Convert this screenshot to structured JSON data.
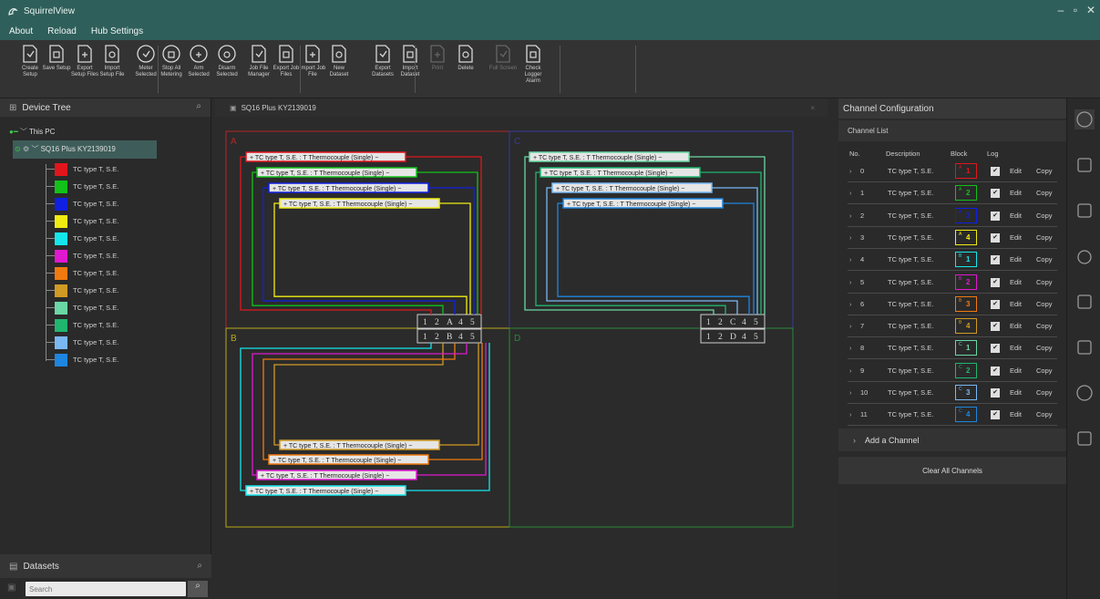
{
  "app": {
    "title": "SquirrelView"
  },
  "menu": [
    "About",
    "Reload",
    "Hub Settings"
  ],
  "toolbar": [
    {
      "label": "Create Setup",
      "icon": "create-setup-icon"
    },
    {
      "label": "Save Setup",
      "icon": "save-setup-icon"
    },
    {
      "label": "Export Setup Files",
      "icon": "export-setup-icon"
    },
    {
      "label": "Import Setup File",
      "icon": "import-setup-icon"
    },
    {
      "label": "Meter Selected",
      "icon": "meter-icon"
    },
    {
      "label": "Stop All Metering",
      "icon": "stop-metering-icon"
    },
    {
      "label": "Arm Selected",
      "icon": "arm-icon"
    },
    {
      "label": "Disarm Selected",
      "icon": "disarm-icon"
    },
    {
      "label": "Job File Manager",
      "icon": "job-file-manager-icon"
    },
    {
      "label": "Export Job Files",
      "icon": "export-job-icon"
    },
    {
      "label": "Import Job File",
      "icon": "import-job-icon"
    },
    {
      "label": "New Dataset",
      "icon": "new-dataset-icon"
    },
    {
      "label": "Export Datasets",
      "icon": "export-datasets-icon"
    },
    {
      "label": "Import Dataset",
      "icon": "import-dataset-icon"
    },
    {
      "label": "Print",
      "icon": "print-icon"
    },
    {
      "label": "Delete",
      "icon": "delete-icon"
    },
    {
      "label": "Full Screen",
      "icon": "full-screen-icon"
    },
    {
      "label": "Check Logger Alarm",
      "icon": "bell-icon"
    }
  ],
  "device_tree": {
    "title": "Device Tree",
    "root": "This PC",
    "logger": "SQ16 Plus KY2139019"
  },
  "channel_desc": "TC type T, S.E.",
  "channel_colors": [
    "#e0161c",
    "#12c21a",
    "#1020e0",
    "#f0ec12",
    "#14e6ec",
    "#e018d0",
    "#f07a10",
    "#d09a24",
    "#6ad8a4",
    "#20b66e",
    "#7ab8f2",
    "#1e86e0"
  ],
  "datasets": {
    "title": "Datasets",
    "search_placeholder": "Search"
  },
  "center": {
    "tab": "SQ16 Plus KY2139019",
    "quadrants": [
      "A",
      "B",
      "C",
      "D"
    ],
    "wire_label": "TC type T, S.E. : T Thermocouple (Single)",
    "terminals": {
      "A": [
        "1",
        "2",
        "A",
        "4",
        "5"
      ],
      "B": [
        "1",
        "2",
        "B",
        "4",
        "5"
      ],
      "C": [
        "1",
        "2",
        "C",
        "4",
        "5"
      ],
      "D": [
        "1",
        "2",
        "D",
        "4",
        "5"
      ]
    }
  },
  "config": {
    "title": "Channel Configuration",
    "list_title": "Channel List",
    "cols": {
      "no": "No.",
      "desc": "Description",
      "block": "Block",
      "log": "Log"
    },
    "edit": "Edit",
    "copy": "Copy",
    "check": "✔",
    "channels": [
      {
        "no": "0",
        "desc": "TC type T, S.E.",
        "blk": "A",
        "num": "1",
        "color": "#e0161c"
      },
      {
        "no": "1",
        "desc": "TC type T, S.E.",
        "blk": "A",
        "num": "2",
        "color": "#12c21a"
      },
      {
        "no": "2",
        "desc": "TC type T, S.E.",
        "blk": "A",
        "num": "3",
        "color": "#1020e0"
      },
      {
        "no": "3",
        "desc": "TC type T, S.E.",
        "blk": "A",
        "num": "4",
        "color": "#f0ec12"
      },
      {
        "no": "4",
        "desc": "TC type T, S.E.",
        "blk": "B",
        "num": "1",
        "color": "#14e6ec"
      },
      {
        "no": "5",
        "desc": "TC type T, S.E.",
        "blk": "B",
        "num": "2",
        "color": "#e018d0"
      },
      {
        "no": "6",
        "desc": "TC type T, S.E.",
        "blk": "B",
        "num": "3",
        "color": "#f07a10"
      },
      {
        "no": "7",
        "desc": "TC type T, S.E.",
        "blk": "B",
        "num": "4",
        "color": "#d09a24"
      },
      {
        "no": "8",
        "desc": "TC type T, S.E.",
        "blk": "C",
        "num": "1",
        "color": "#6ad8a4"
      },
      {
        "no": "9",
        "desc": "TC type T, S.E.",
        "blk": "C",
        "num": "2",
        "color": "#20b66e"
      },
      {
        "no": "10",
        "desc": "TC type T, S.E.",
        "blk": "C",
        "num": "3",
        "color": "#7ab8f2"
      },
      {
        "no": "11",
        "desc": "TC type T, S.E.",
        "blk": "C",
        "num": "4",
        "color": "#1e86e0"
      }
    ],
    "add": "Add a Channel",
    "clear": "Clear All Channels"
  },
  "rail": [
    "settings-icon",
    "logger-icon",
    "tools-icon",
    "alarm-clock-icon",
    "stack-icon",
    "module-icon",
    "info-icon",
    "gear-icon"
  ]
}
